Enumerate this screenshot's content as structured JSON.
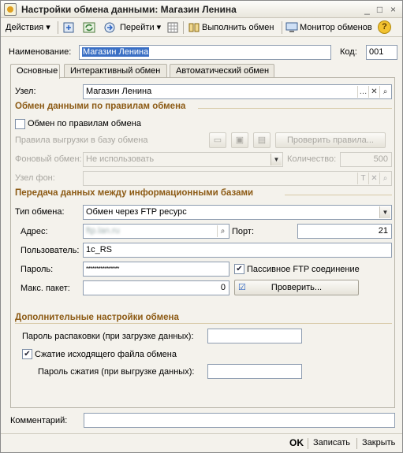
{
  "window": {
    "title": "Настройки обмена данными: Магазин Ленина"
  },
  "toolbar": {
    "actions": "Действия",
    "goto": "Перейти",
    "run_exchange": "Выполнить обмен",
    "monitor": "Монитор обменов",
    "help": "?"
  },
  "header": {
    "name_label": "Наименование:",
    "name_value": "Магазин Ленина",
    "code_label": "Код:",
    "code_value": "001"
  },
  "tabs": [
    "Основные",
    "Интерактивный обмен",
    "Автоматический обмен"
  ],
  "main": {
    "node_label": "Узел:",
    "node_value": "Магазин Ленина",
    "section_rules": "Обмен данными по правилам обмена",
    "rules_checkbox": "Обмен по правилам обмена",
    "upload_rules_label": "Правила выгрузки в базу обмена",
    "check_rules_btn": "Проверить правила...",
    "bg_exchange_label": "Фоновый обмен:",
    "bg_exchange_value": "Не использовать",
    "count_label": "Количество:",
    "count_value": "500",
    "bg_node_label": "Узел фон:",
    "section_transfer": "Передача данных между информационными базами",
    "exchange_type_label": "Тип обмена:",
    "exchange_type_value": "Обмен через FTP ресурс",
    "address_label": "Адрес:",
    "address_value": "ftp.lan.ru",
    "port_label": "Порт:",
    "port_value": "21",
    "user_label": "Пользователь:",
    "user_value": "1c_RS",
    "password_label": "Пароль:",
    "password_value": "****************",
    "passive_ftp": "Пассивное FTP соединение",
    "max_packet_label": "Макс. пакет:",
    "max_packet_value": "0",
    "check_btn": "Проверить...",
    "section_extra": "Дополнительные настройки обмена",
    "unpack_password_label": "Пароль распаковки (при загрузке данных):",
    "compress_checkbox": "Сжатие исходящего файла обмена",
    "compress_password_label": "Пароль сжатия (при выгрузке данных):"
  },
  "footer": {
    "comment_label": "Комментарий:",
    "ok": "OK",
    "save": "Записать",
    "close": "Закрыть"
  },
  "colors": {
    "accent": "#8c5a14",
    "selection": "#3a6fc4"
  }
}
